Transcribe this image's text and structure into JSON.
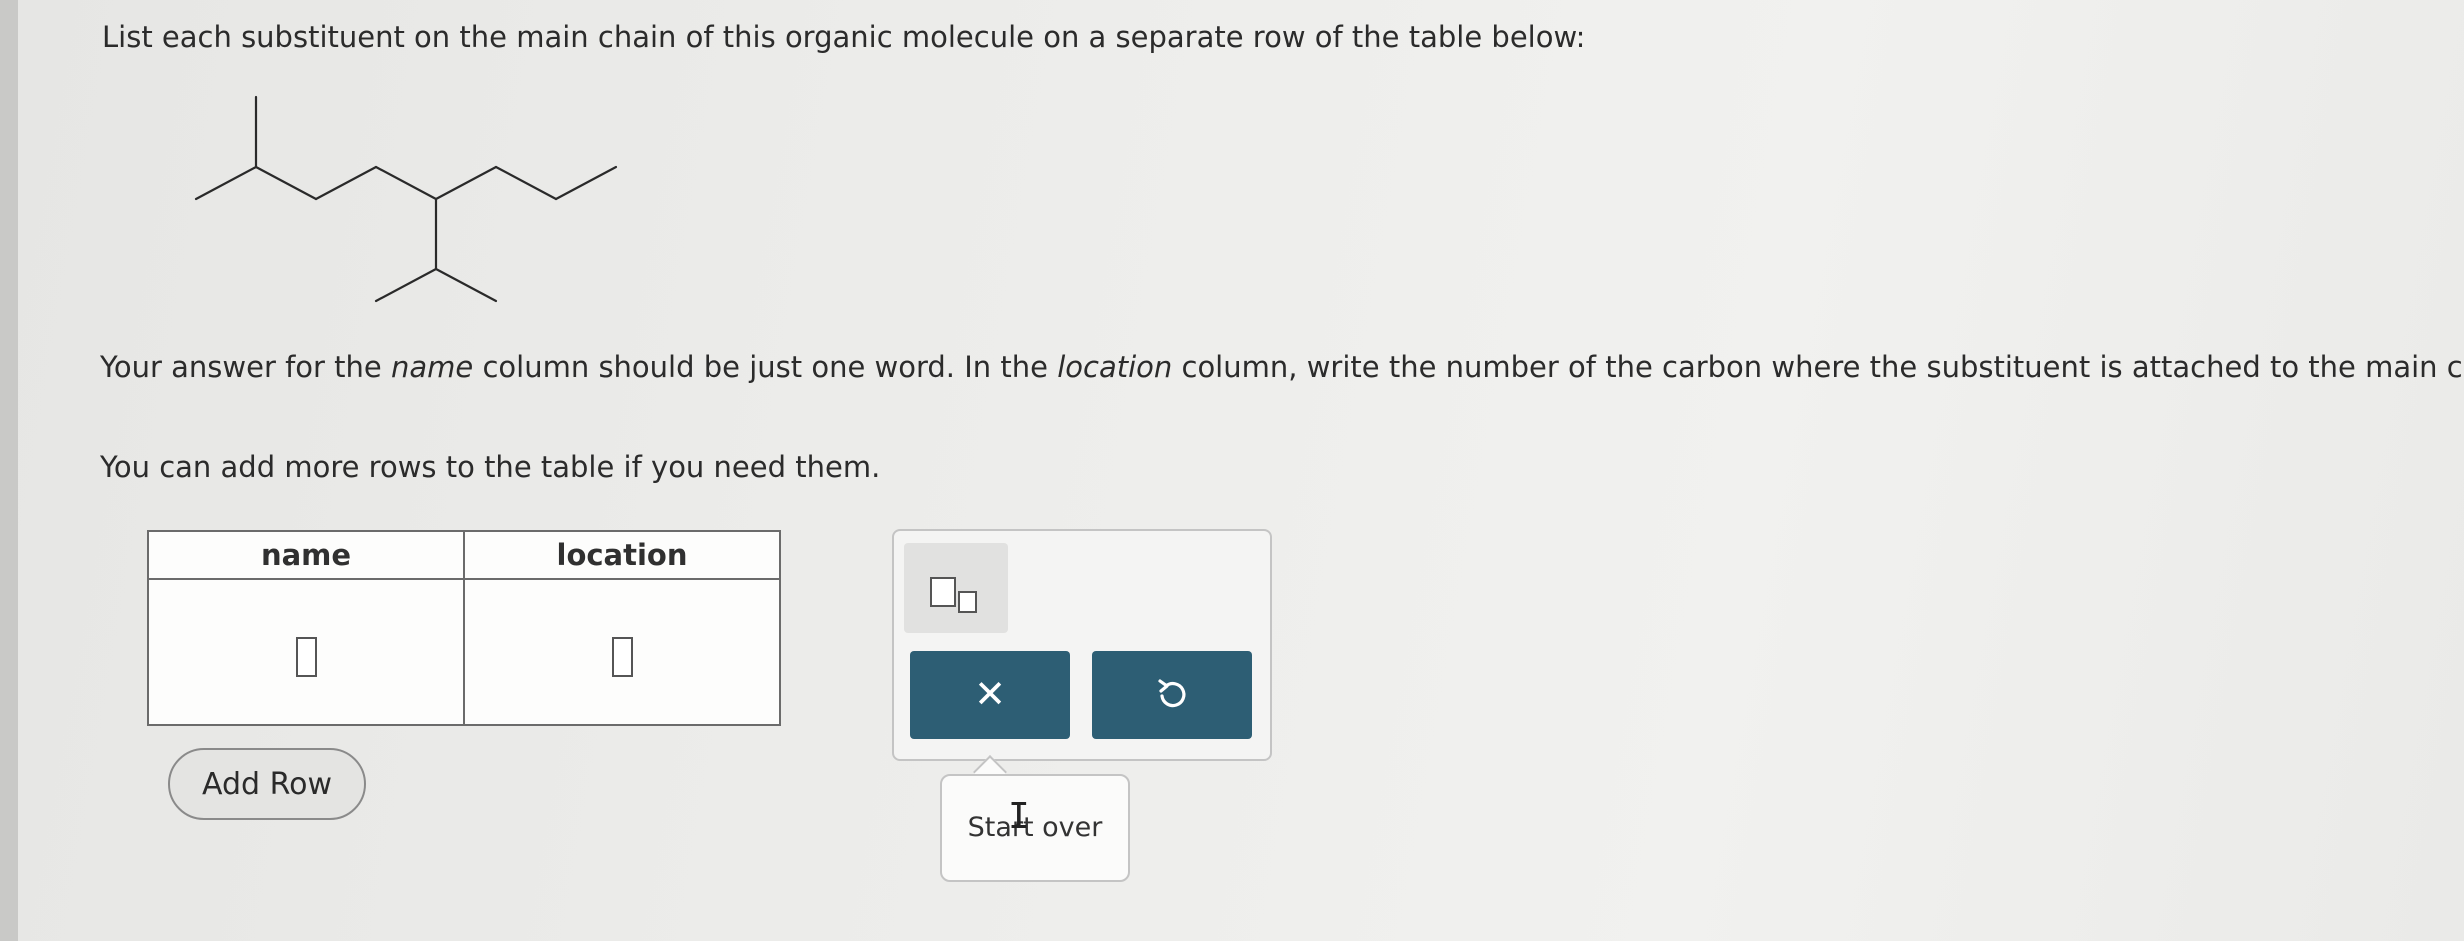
{
  "question": {
    "prompt": "List each substituent on the main chain of this organic molecule on a separate row of the table below:",
    "instruction_1": "Your answer for the ",
    "instruction_name_word": "name",
    "instruction_2": " column should be just one word. In the ",
    "instruction_location_word": "location",
    "instruction_3": " column, write the number of the carbon where the substituent is attached to the main chain.",
    "add_more_text": "You can add more rows to the table if you need them."
  },
  "table": {
    "headers": [
      "name",
      "location"
    ],
    "rows": [
      {
        "name": "",
        "location": ""
      }
    ]
  },
  "buttons": {
    "add_row": "Add Row",
    "clear_symbol": "✕",
    "undo_icon": "undo-icon",
    "subscript_icon": "subscript-icon"
  },
  "tooltip": {
    "text": "Start over"
  },
  "colors": {
    "button_teal": "#2d5e74"
  }
}
